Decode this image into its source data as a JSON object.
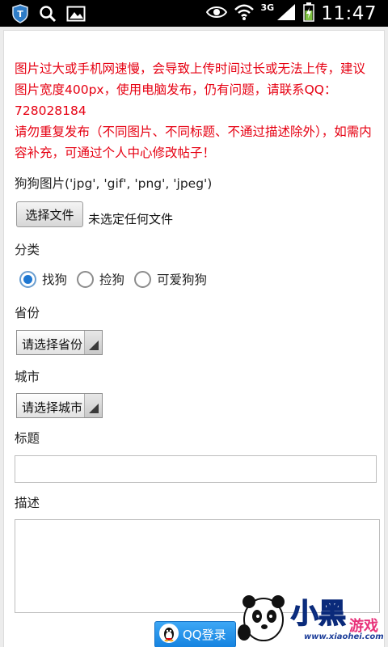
{
  "status_bar": {
    "network": "3G",
    "time": "11:47"
  },
  "notice": {
    "line1": "图片过大或手机网速慢，会导致上传时间过长或无法上传，建议图片宽度400px，使用电脑发布，仍有问题，请联系QQ：728028184",
    "line2": "请勿重复发布（不同图片、不同标题、不通过描述除外），如需内容补充，可通过个人中心修改帖子！"
  },
  "form": {
    "image_label": "狗狗图片('jpg', 'gif', 'png', 'jpeg')",
    "file_button": "选择文件",
    "file_status": "未选定任何文件",
    "category_label": "分类",
    "categories": [
      {
        "label": "找狗",
        "selected": true
      },
      {
        "label": "捡狗",
        "selected": false
      },
      {
        "label": "可爱狗狗",
        "selected": false
      }
    ],
    "province_label": "省份",
    "province_select": "请选择省份",
    "city_label": "城市",
    "city_select": "请选择城市",
    "title_label": "标题",
    "title_value": "",
    "description_label": "描述",
    "description_value": "",
    "qq_login": "QQ登录"
  },
  "watermark": {
    "brand": "小黑游戏",
    "site": "www.xiaohei.com"
  },
  "colors": {
    "notice": "#e60012",
    "radio_selected": "#1f78d2",
    "qq_button": "#2a95ea"
  }
}
